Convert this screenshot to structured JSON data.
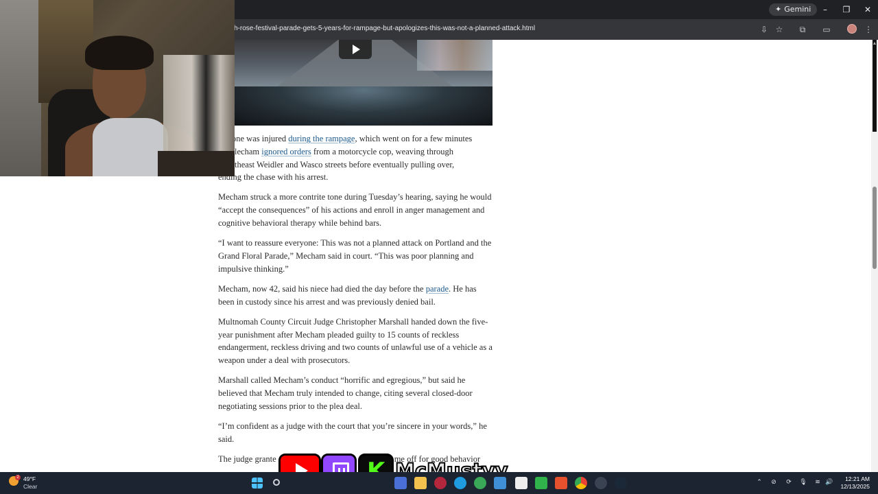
{
  "browser": {
    "gemini_label": "Gemini",
    "url": "h-rose-festival-parade-gets-5-years-for-rampage-but-apologizes-this-was-not-a-planned-attack.html"
  },
  "article": {
    "p1": {
      "pre": "one was injured ",
      "link1": "during the rampage",
      "mid": ", which went on for a few minutes",
      "line2_pre": "lecham ",
      "link2": "ignored orders",
      "post": " from a motorcycle cop, weaving through",
      "line3": "theast Weidler and Wasco streets before eventually pulling over,",
      "line4": "ending the chase with his arrest."
    },
    "p2": "Mecham struck a more contrite tone during Tuesday’s hearing, saying he would “accept the consequences” of his actions and enroll in anger management and cognitive behavioral therapy while behind bars.",
    "p3": "“I want to reassure everyone: This was not a planned attack on Portland and the Grand Floral Parade,” Mecham said in court. “This was poor planning and impulsive thinking.”",
    "p4": {
      "pre": "Mecham, now 42, said his niece had died the day before the ",
      "link": "parade",
      "post": ". He has been in custody since his arrest and was previously denied bail."
    },
    "p5": "Multnomah County Circuit Judge Christopher Marshall handed down the five-year punishment after Mecham pleaded guilty to 15 counts of reckless endangerment, reckless driving and two counts of unlawful use of a vehicle as a weapon under a deal with prosecutors.",
    "p6": "Marshall called Mecham’s conduct “horrific and egregious,” but said he believed that Mecham truly intended to change, citing several closed-door negotiating sessions prior to the plea deal.",
    "p7": "“I’m confident as a judge with the court that you’re sincere in your words,” he said.",
    "p8_pre": "The judge grante",
    "p8_post": "me off for good behavior"
  },
  "overlay": {
    "kick_letter": "K",
    "handle": "McMustyy"
  },
  "taskbar": {
    "weather_badge": "2",
    "temperature": "49°F",
    "condition": "Clear",
    "time": "12:21 AM",
    "date": "12/13/2025"
  }
}
